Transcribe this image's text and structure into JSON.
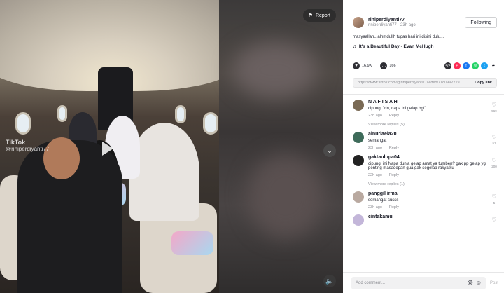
{
  "video": {
    "report_label": "Report",
    "watermark_brand": "TikTok",
    "watermark_handle": "@riniperdiyanti77"
  },
  "author": {
    "username": "riniperdiyanti77",
    "subline": "riniperdiyanti77 · 23h ago",
    "follow_label": "Following",
    "caption": "masyaallah...alhmdullh tugas hari ini disini dulu...",
    "music": "It's a Beautiful Day - Evan McHugh"
  },
  "stats": {
    "likes": "16.9K",
    "comments": "166"
  },
  "share_icons": [
    {
      "name": "embed-icon",
      "glyph": "</>",
      "color": "#2f2f35"
    },
    {
      "name": "pinterest-icon",
      "glyph": "P",
      "color": "#fe2c55"
    },
    {
      "name": "facebook-icon",
      "glyph": "f",
      "color": "#1877f2"
    },
    {
      "name": "whatsapp-icon",
      "glyph": "w",
      "color": "#25d366"
    },
    {
      "name": "twitter-icon",
      "glyph": "t",
      "color": "#1da1f2"
    },
    {
      "name": "share-arrow-icon",
      "glyph": "➦",
      "color": "#ffffff"
    }
  ],
  "link": {
    "url": "https://www.tiktok.com/@riniperdiyanti77/video/7180992219...",
    "copy_label": "Copy link"
  },
  "comments": [
    {
      "name": "N A F I S A H",
      "text": "cipung: \"rin, napa ini gelap bgt\"",
      "time": "23h ago",
      "reply": "Reply",
      "likes": "569",
      "avatar": "#7a6a55",
      "replies": "View more replies (5)"
    },
    {
      "name": "ainurlaela20",
      "text": "semangat",
      "time": "23h ago",
      "reply": "Reply",
      "likes": "51",
      "avatar": "#3e6b5a",
      "replies": ""
    },
    {
      "name": "gaktaulupa04",
      "text": "cipung: ini Napa dunia gelap amat ya tumben? gak pp gelap yg penting masadepan gua gak segelap rakyatku",
      "time": "22h ago",
      "reply": "Reply",
      "likes": "200",
      "avatar": "#222222",
      "replies": "View more replies (1)"
    },
    {
      "name": "panggil irma",
      "text": "semangat susss",
      "time": "23h ago",
      "reply": "Reply",
      "likes": "5",
      "avatar": "#b9a9a0",
      "replies": ""
    },
    {
      "name": "cintakamu",
      "text": "",
      "time": "",
      "reply": "",
      "likes": "",
      "avatar": "#c3b6d9",
      "replies": ""
    }
  ],
  "comment_input": {
    "placeholder": "Add comment...",
    "post_label": "Post"
  }
}
